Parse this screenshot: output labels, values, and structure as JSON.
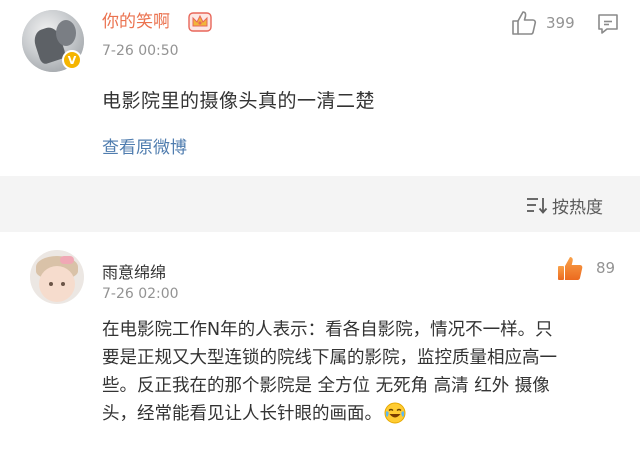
{
  "post": {
    "username": "你的笑啊",
    "timestamp": "7-26 00:50",
    "like_count": "399",
    "text": "电影院里的摄像头真的一清二楚",
    "view_original": "查看原微博",
    "icons": [
      "avatar",
      "verified-badge-icon",
      "crown-icon",
      "thumbs-up-icon",
      "comment-icon"
    ]
  },
  "sort_bar": {
    "label": "按热度",
    "icon": "sort-icon"
  },
  "comment": {
    "username": "雨意绵绵",
    "timestamp": "7-26 02:00",
    "like_count": "89",
    "text_lines": [
      "在电影院工作N年的人表示：看各自影院，情况不一样。只",
      "要是正规又大型连锁的院线下属的影院，监控质量相应高一",
      "些。反正我在的那个影院是 全方位 无死角 高清 红外 摄像",
      "头，经常能看见让人长针眼的画面。"
    ],
    "icons": [
      "avatar",
      "thumbs-up-filled-icon",
      "laugh-cry-emoji-icon"
    ]
  },
  "colors": {
    "username_main": "#eb7350",
    "link": "#507daf",
    "meta_gray": "#939393",
    "like_active": "#f07b33",
    "badge": "#f5b500",
    "separator_bg": "#f4f4f4"
  }
}
